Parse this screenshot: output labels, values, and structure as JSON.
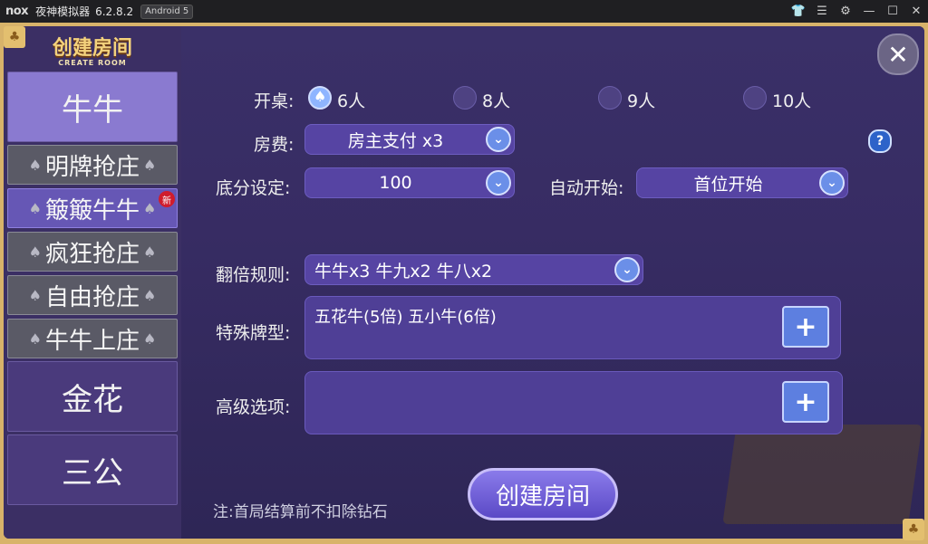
{
  "titlebar": {
    "logo": "nox",
    "app_name": "夜神模拟器",
    "version": "6.2.8.2",
    "android": "Android 5",
    "controls": [
      "shirt-icon",
      "menu-icon",
      "settings-icon",
      "minimize-icon",
      "maximize-icon",
      "close-icon"
    ]
  },
  "sidebar": {
    "header_cn": "创建房间",
    "header_en": "CREATE ROOM",
    "items": [
      {
        "label": "牛牛"
      },
      {
        "label": "明牌抢庄"
      },
      {
        "label": "簸簸牛牛",
        "badge": "新"
      },
      {
        "label": "疯狂抢庄"
      },
      {
        "label": "自由抢庄"
      },
      {
        "label": "牛牛上庄"
      },
      {
        "label": "金花"
      },
      {
        "label": "三公"
      }
    ]
  },
  "form": {
    "table_label": "开桌:",
    "players": [
      {
        "label": "6人",
        "selected": true
      },
      {
        "label": "8人",
        "selected": false
      },
      {
        "label": "9人",
        "selected": false
      },
      {
        "label": "10人",
        "selected": false
      }
    ],
    "fee_label": "房费:",
    "fee_value": "房主支付 x3",
    "base_label": "底分设定:",
    "base_value": "100",
    "autostart_label": "自动开始:",
    "autostart_value": "首位开始",
    "multiplier_label": "翻倍规则:",
    "multiplier_value": "牛牛x3  牛九x2  牛八x2",
    "special_label": "特殊牌型:",
    "special_value": "五花牛(5倍)  五小牛(6倍)",
    "advanced_label": "高级选项:",
    "advanced_value": "",
    "help": "?",
    "close": "✕",
    "plus": "+",
    "note": "注:首局结算前不扣除钻石",
    "create_button": "创建房间"
  },
  "colors": {
    "accent": "#5644a3",
    "frame": "#d8b36a",
    "button": "#6b8fe8"
  }
}
